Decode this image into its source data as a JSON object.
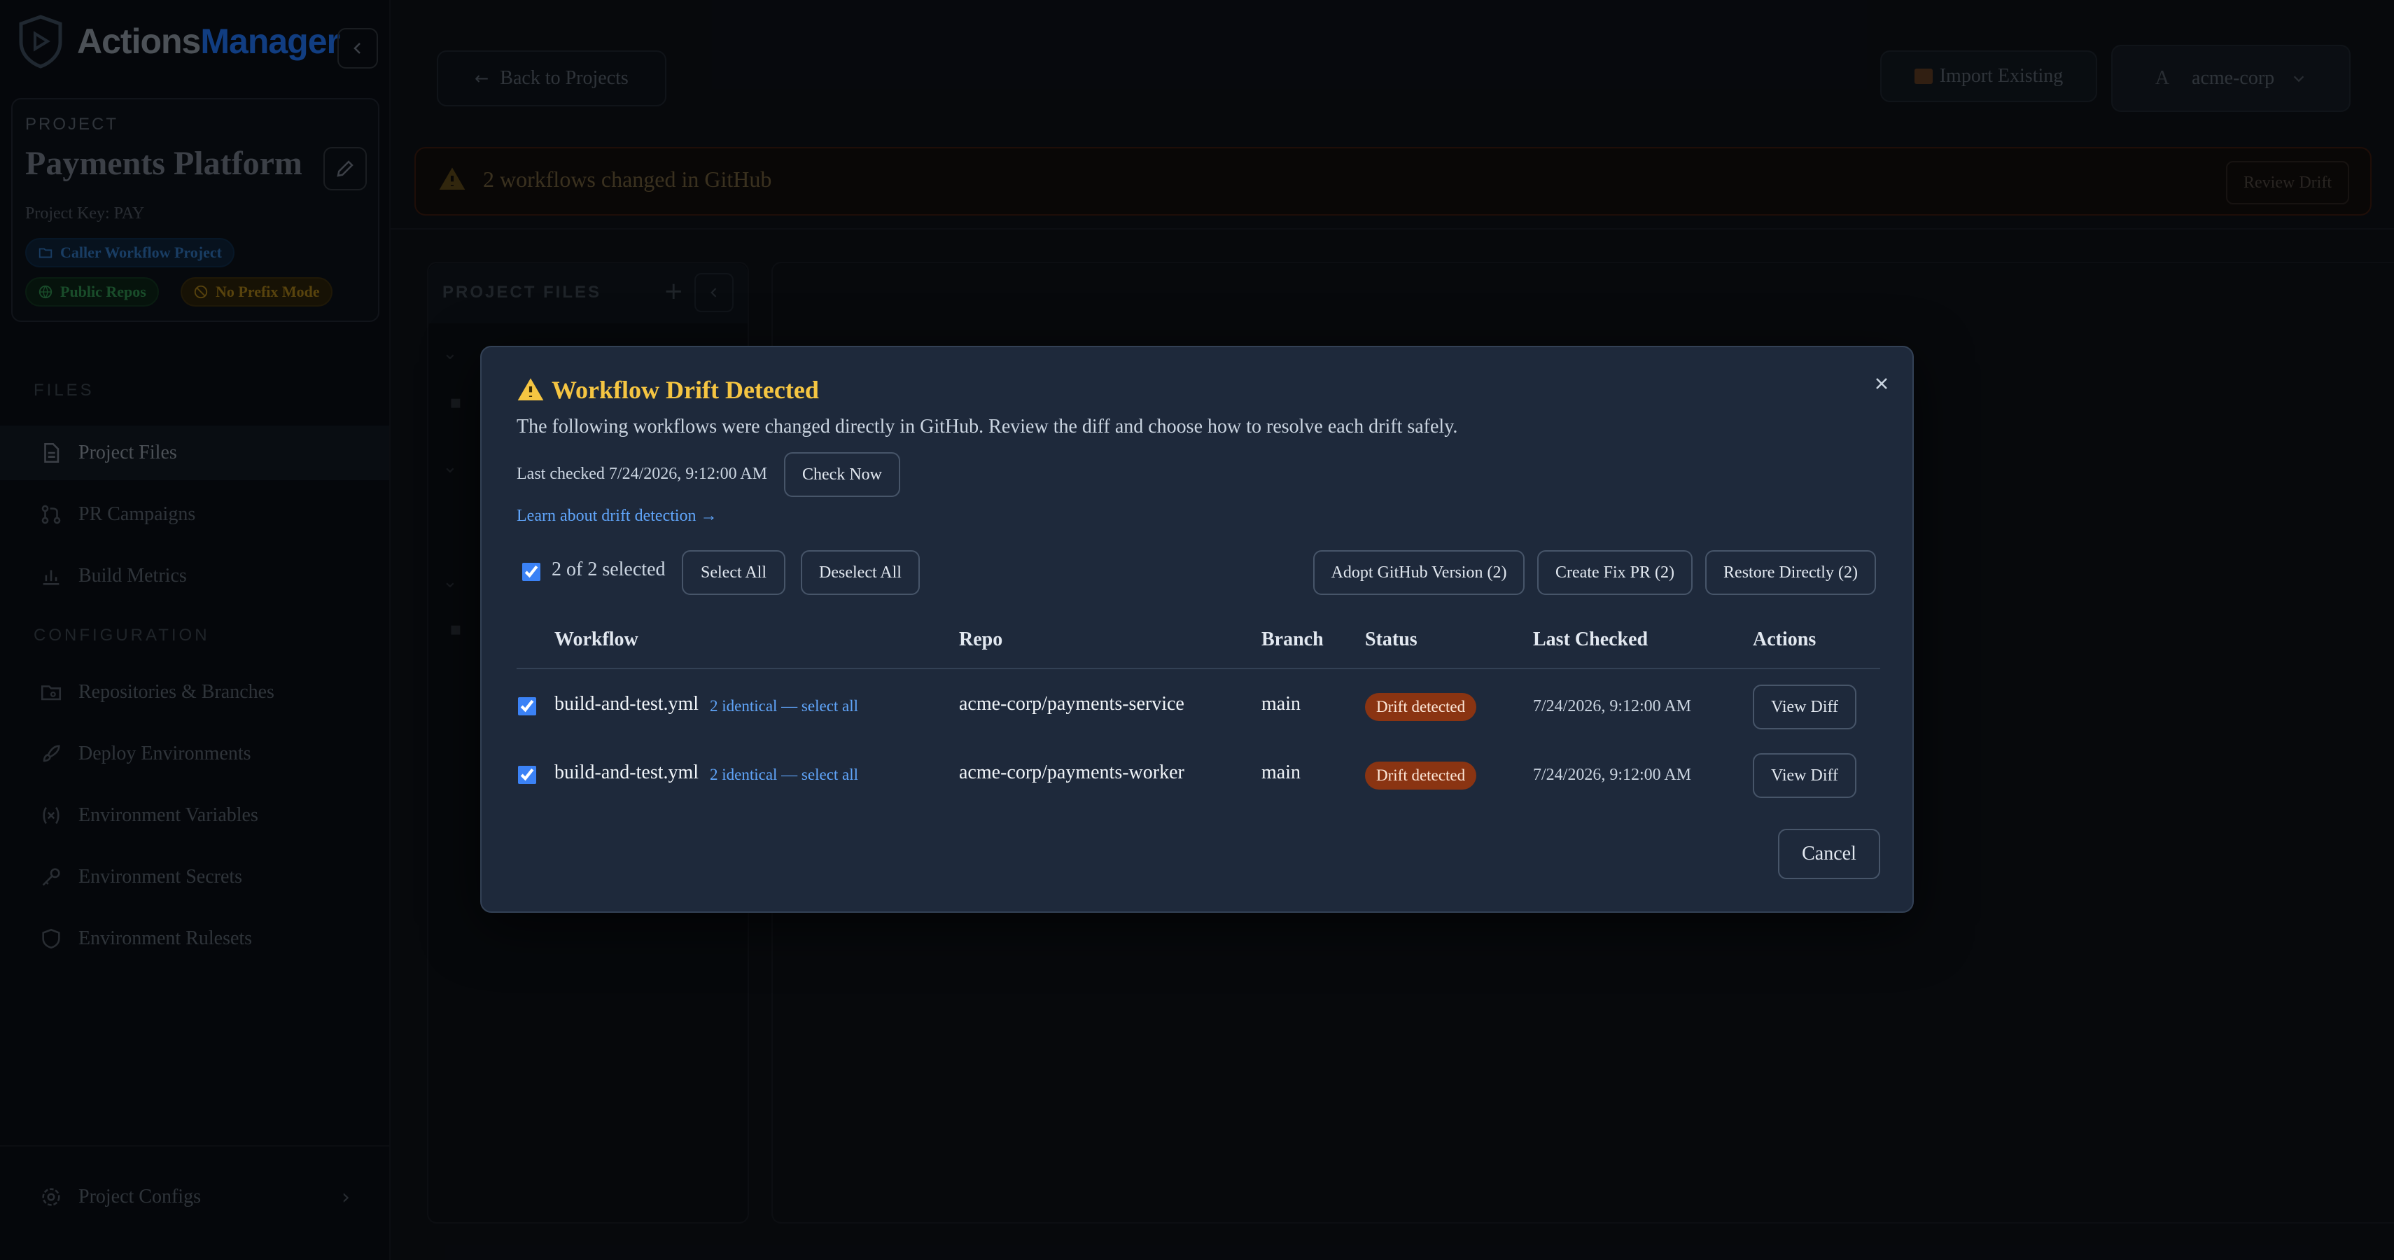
{
  "app": {
    "logo_part1": "Actions",
    "logo_part2": "Manager"
  },
  "project": {
    "label": "PROJECT",
    "name": "Payments Platform",
    "key": "Project Key: PAY",
    "badges": {
      "caller": "Caller Workflow Project",
      "public": "Public Repos",
      "prefix": "No Prefix Mode"
    }
  },
  "sidebar": {
    "files_heading": "FILES",
    "config_heading": "CONFIGURATION",
    "items": [
      {
        "label": "Project Files",
        "icon": "file-icon"
      },
      {
        "label": "PR Campaigns",
        "icon": "git-pull-request-icon"
      },
      {
        "label": "Build Metrics",
        "icon": "bar-chart-icon"
      },
      {
        "label": "Repositories & Branches",
        "icon": "folder-git-icon"
      },
      {
        "label": "Deploy Environments",
        "icon": "rocket-icon"
      },
      {
        "label": "Environment Variables",
        "icon": "variable-icon"
      },
      {
        "label": "Environment Secrets",
        "icon": "key-icon"
      },
      {
        "label": "Environment Rulesets",
        "icon": "shield-icon"
      }
    ],
    "footer": "Project Configs"
  },
  "topbar": {
    "back": "Back to Projects",
    "import": "Import Existing",
    "org_avatar": "A",
    "org": "acme-corp"
  },
  "banner": {
    "text": "2 workflows changed in GitHub",
    "button": "Review Drift"
  },
  "files_panel": {
    "title": "PROJECT FILES"
  },
  "modal": {
    "title_icon": "⚠️",
    "title": "Workflow Drift Detected",
    "description": "The following workflows were changed directly in GitHub. Review the diff and choose how to resolve each drift safely.",
    "last_checked": "Last checked 7/24/2026, 9:12:00 AM",
    "check_now": "Check Now",
    "learn": "Learn about drift detection →",
    "selection": "2 of 2 selected",
    "select_all": "Select All",
    "deselect_all": "Deselect All",
    "adopt": "Adopt GitHub Version (2)",
    "create_pr": "Create Fix PR (2)",
    "restore": "Restore Directly (2)",
    "columns": [
      "Workflow",
      "Repo",
      "Branch",
      "Status",
      "Last Checked",
      "Actions"
    ],
    "rows": [
      {
        "workflow": "build-and-test.yml",
        "identical": "2 identical — select all",
        "repo": "acme-corp/payments-service",
        "branch": "main",
        "status": "Drift detected",
        "checked": "7/24/2026, 9:12:00 AM",
        "action": "View Diff"
      },
      {
        "workflow": "build-and-test.yml",
        "identical": "2 identical — select all",
        "repo": "acme-corp/payments-worker",
        "branch": "main",
        "status": "Drift detected",
        "checked": "7/24/2026, 9:12:00 AM",
        "action": "View Diff"
      }
    ],
    "cancel": "Cancel"
  },
  "colors": {
    "warning": "#f5c542",
    "accent": "#3b82f6",
    "status_badge": "#8a3412",
    "modal_bg": "#1e293b"
  }
}
